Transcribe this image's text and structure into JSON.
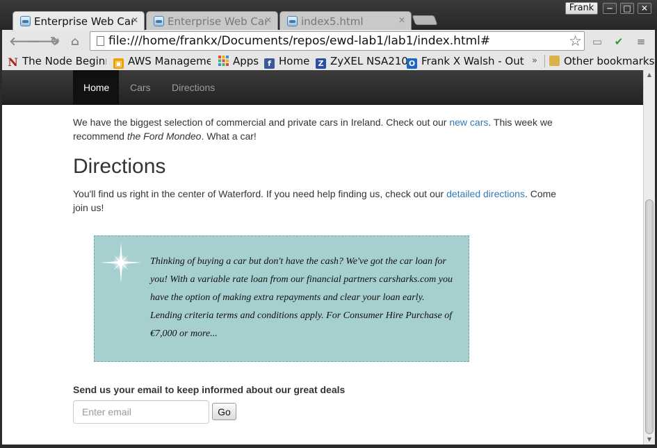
{
  "window": {
    "profile_name": "Frank",
    "controls": {
      "minimize": "−",
      "maximize": "□",
      "close": "✕"
    }
  },
  "tabs": [
    {
      "title": "Enterprise Web Cars",
      "active": true,
      "close": "✕"
    },
    {
      "title": "Enterprise Web Cars",
      "active": false,
      "close": "✕"
    },
    {
      "title": "index5.html",
      "active": false,
      "close": "✕"
    }
  ],
  "toolbar": {
    "url": "file:///home/frankx/Documents/repos/ewd-lab1/lab1/index.html#",
    "back_icon": "arrow-left-icon",
    "forward_icon": "arrow-right-icon",
    "reload_icon": "reload-icon",
    "home_icon": "home-icon",
    "star_icon": "star-icon",
    "glyphs": {
      "back": "🡐",
      "forward": "🡒",
      "reload": "↻",
      "home": "⌂",
      "star": "☆",
      "cast": "▭",
      "check": "✔",
      "menu": "≡"
    }
  },
  "bookmarks": {
    "items": [
      {
        "label": "The Node Beginner",
        "icon": "n-icon",
        "glyph": "N"
      },
      {
        "label": "AWS Management Console",
        "icon": "aws-icon",
        "glyph": "▣"
      },
      {
        "label": "Apps",
        "icon": "apps-grid-icon"
      },
      {
        "label": "Home",
        "icon": "facebook-icon",
        "glyph": "f"
      },
      {
        "label": "ZyXEL NSA210",
        "icon": "zyxel-icon",
        "glyph": "Z"
      },
      {
        "label": "Frank X Walsh - Outlook",
        "icon": "outlook-icon",
        "glyph": "O"
      }
    ],
    "more": "»",
    "other": {
      "label": "Other bookmarks",
      "icon": "folder-icon"
    }
  },
  "site_nav": {
    "items": [
      {
        "label": "Home",
        "active": true
      },
      {
        "label": "Cars",
        "active": false
      },
      {
        "label": "Directions",
        "active": false
      }
    ]
  },
  "content": {
    "intro": {
      "before_link": "We have the biggest selection of commercial and private cars in Ireland. Check out our ",
      "link": "new cars",
      "after_link": ". This week we recommend ",
      "emphasis": "the Ford Mondeo",
      "end": ". What a car!"
    },
    "directions_heading": "Directions",
    "directions": {
      "before_link": "You'll find us right in the center of Waterford. If you need help finding us, check out our ",
      "link": "detailed directions",
      "after_link": ". Come join us!"
    },
    "promo": {
      "text": "Thinking of buying a car but don't have the cash? We've got the car loan for you! With a variable rate loan from our financial partners carsharks.com you have the option of making extra repayments and clear your loan early. Lending criteria terms and conditions apply. For Consumer Hire Purchase of €7,000 or more...",
      "bg_color": "#a6cfcf"
    },
    "signup": {
      "label": "Send us your email to keep informed about our great deals",
      "placeholder": "Enter email",
      "button": "Go"
    }
  },
  "colors": {
    "link": "#337ab7",
    "navbar": "#222222",
    "nav_active": "#121212"
  }
}
